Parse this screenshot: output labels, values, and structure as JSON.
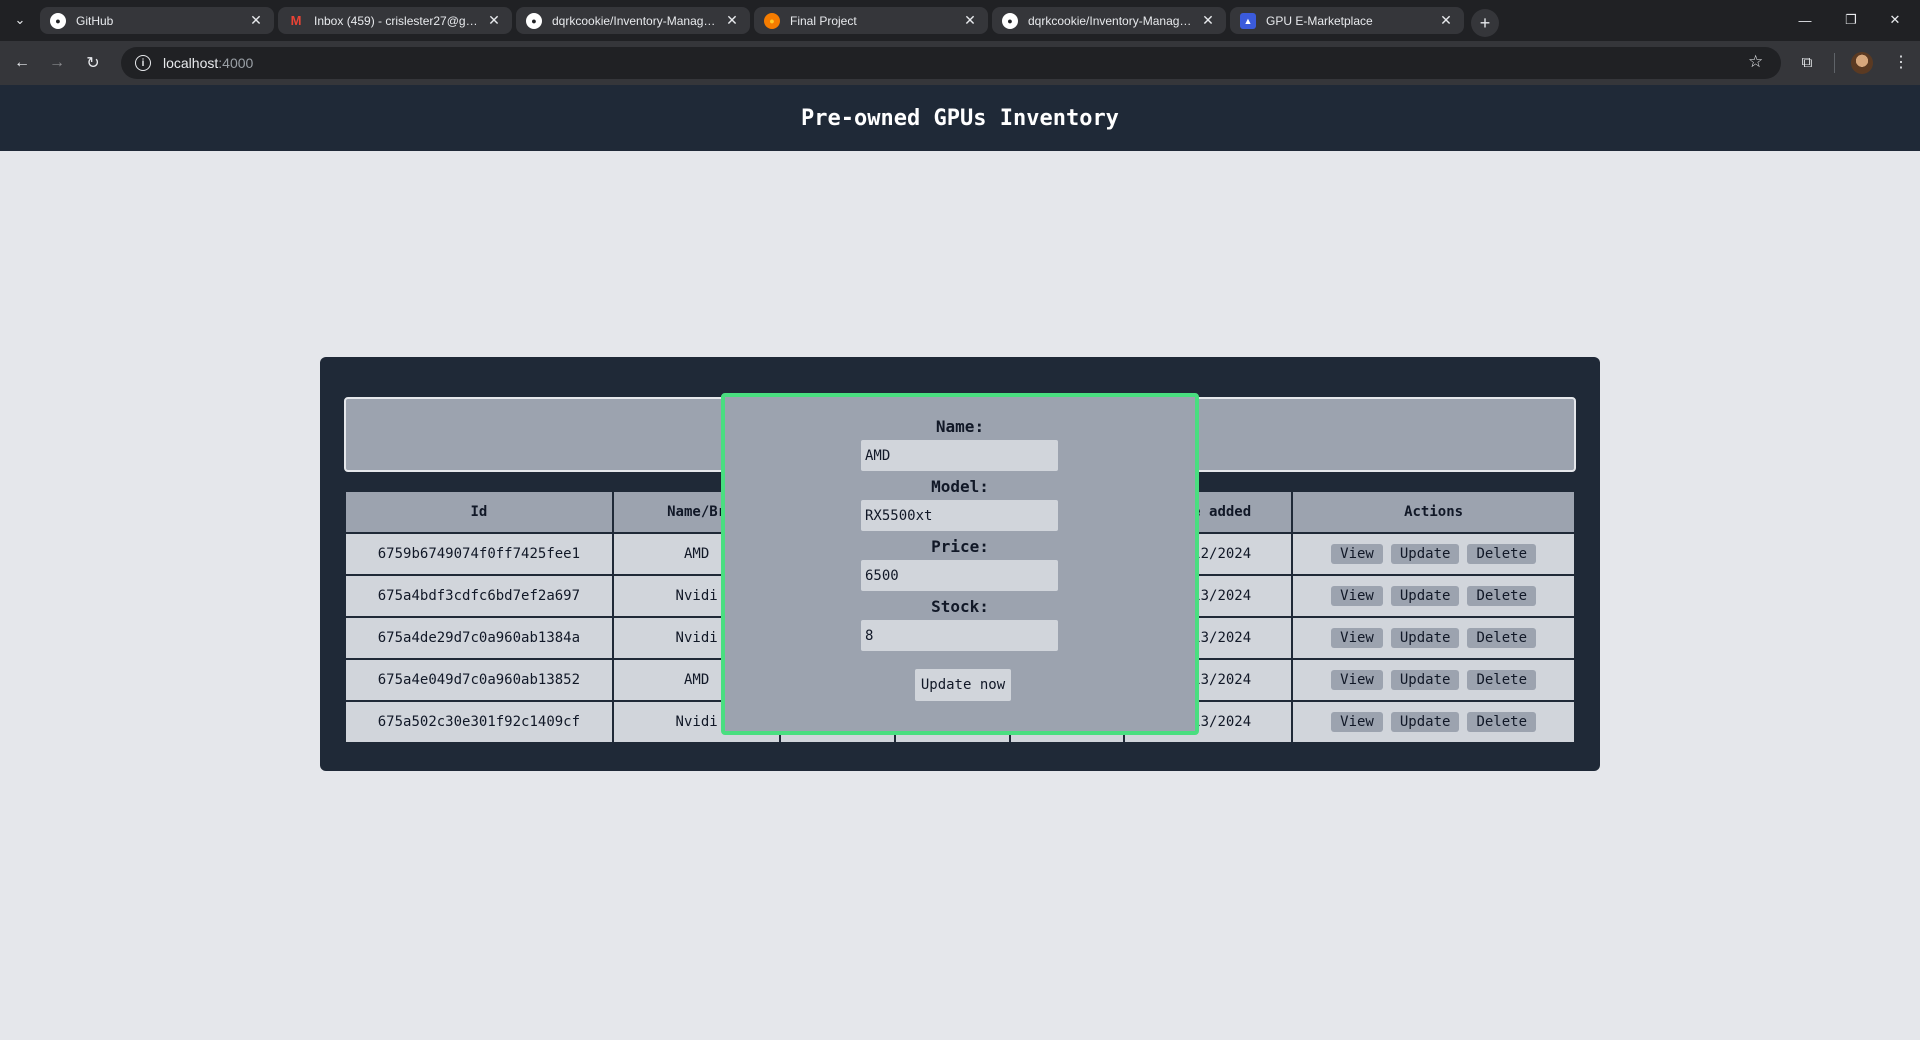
{
  "browser": {
    "tabs": [
      {
        "title": "GitHub",
        "icon": "github-icon",
        "color": "#ffffff"
      },
      {
        "title": "Inbox (459) - crislester27@gmail.com",
        "icon": "gmail-icon",
        "color": "#ea4335"
      },
      {
        "title": "dqrkcookie/Inventory-Management",
        "icon": "github-icon",
        "color": "#ffffff"
      },
      {
        "title": "Final Project",
        "icon": "firebase-icon",
        "color": "#f57c00"
      },
      {
        "title": "dqrkcookie/Inventory-Management",
        "icon": "github-icon",
        "color": "#ffffff"
      },
      {
        "title": "GPU E-Marketplace",
        "icon": "app-icon",
        "color": "#3b5bdb"
      }
    ],
    "address": {
      "host": "localhost",
      "port": ":4000"
    }
  },
  "page": {
    "title": "Pre-owned GPUs Inventory"
  },
  "table": {
    "headers": [
      "Id",
      "Name/Br",
      "",
      "",
      "",
      "e added",
      "Actions"
    ],
    "rows": [
      {
        "id": "6759b6749074f0ff7425fee1",
        "name": "AMD",
        "date": "12/2024"
      },
      {
        "id": "675a4bdf3cdfc6bd7ef2a697",
        "name": "Nvidi",
        "date": "13/2024"
      },
      {
        "id": "675a4de29d7c0a960ab1384a",
        "name": "Nvidi",
        "date": "13/2024"
      },
      {
        "id": "675a4e049d7c0a960ab13852",
        "name": "AMD",
        "date": "13/2024"
      },
      {
        "id": "675a502c30e301f92c1409cf",
        "name": "Nvidi",
        "date": "13/2024"
      }
    ],
    "actions": {
      "view": "View",
      "update": "Update",
      "delete": "Delete"
    }
  },
  "modal": {
    "name_label": "Name:",
    "name_value": "AMD",
    "model_label": "Model:",
    "model_value": "RX5500xt",
    "price_label": "Price:",
    "price_value": "6500",
    "stock_label": "Stock:",
    "stock_value": "8",
    "submit_label": "Update now"
  },
  "colors": {
    "header_bg": "#1f2937",
    "accent_border": "#4ade80",
    "cell_bg": "#d1d5db",
    "header_cell_bg": "#9ca3af"
  }
}
